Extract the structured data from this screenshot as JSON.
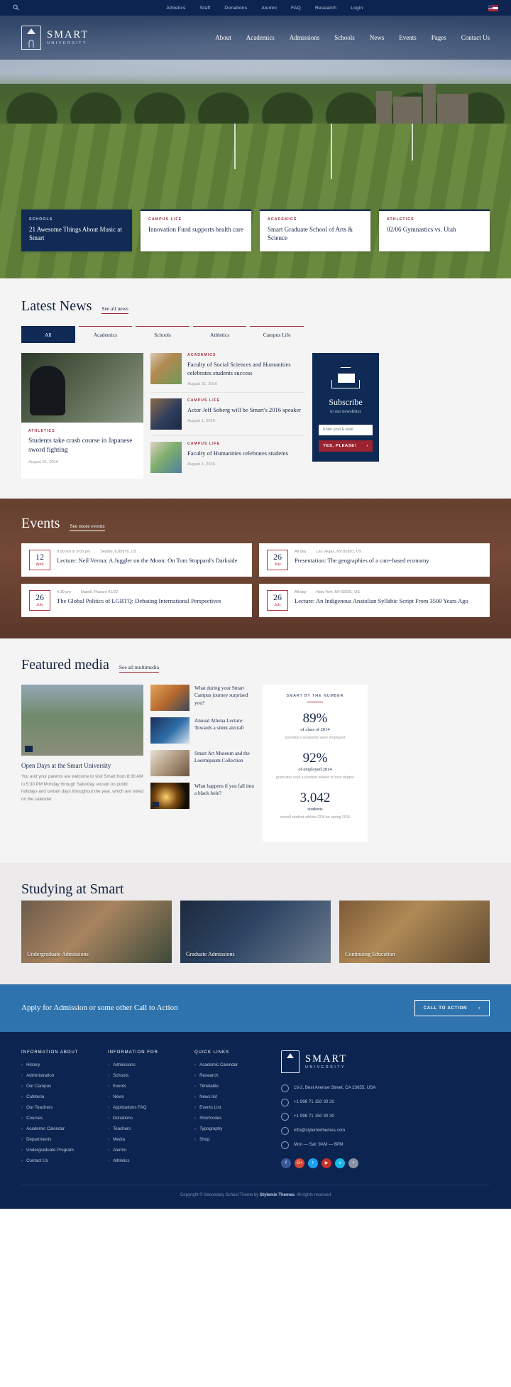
{
  "topbar": {
    "search_icon": "search-icon",
    "links": [
      "Athletics",
      "Staff",
      "Donations",
      "Alumni",
      "FAQ",
      "Research",
      "Login"
    ],
    "flag": "us-flag-icon"
  },
  "header": {
    "brand_main": "SMART",
    "brand_sub": "UNIVERSITY",
    "nav": [
      "About",
      "Academics",
      "Admissions",
      "Schools",
      "News",
      "Events",
      "Pages",
      "Contact Us"
    ]
  },
  "feature_cards": [
    {
      "category": "SCHOOLS",
      "title": "21 Awesome Things About Music at Smart",
      "dark": true
    },
    {
      "category": "CAMPUS LIFE",
      "title": "Innovation Fund supports health care",
      "dark": false
    },
    {
      "category": "ACADEMICS",
      "title": "Smart Graduate School of Arts & Science",
      "dark": false
    },
    {
      "category": "ATHLETICS",
      "title": "02/06 Gymnastics vs. Utah",
      "dark": false
    }
  ],
  "news": {
    "title": "Latest News",
    "see_all": "See all news",
    "tabs": [
      "All",
      "Academics",
      "Schools",
      "Athletics",
      "Campus Life"
    ],
    "active_tab": "All",
    "featured": {
      "category": "ATHLETICS",
      "title": "Students take crash course in Japanese sword fighting",
      "date": "August 31, 2016"
    },
    "items": [
      {
        "category": "ACADEMICS",
        "title": "Faculty of Social Sciences and Humanities celebrates students success",
        "date": "August 31, 2016"
      },
      {
        "category": "CAMPUS LIFE",
        "title": "Actor Jeff Soberg will be Smart's 2016 speaker",
        "date": "August 1, 2016"
      },
      {
        "category": "CAMPUS LIFE",
        "title": "Faculty of Humanities celebrates students",
        "date": "August 1, 2016"
      }
    ],
    "subscribe": {
      "icon": "envelope-icon",
      "title": "Subscribe",
      "subtitle": "to our newsletter",
      "placeholder": "Enter your E-mail",
      "button": "YES, PLEASE!",
      "button_arrow": "›"
    }
  },
  "events": {
    "title": "Events",
    "see_all": "See more events",
    "items": [
      {
        "day": "12",
        "month": "April",
        "time": "8:00 am to 9:00 pm",
        "location": "Seattle, IL85976, US",
        "title": "Lecture: Neil Verma: A Juggler on the Moon: On Tom Stoppard's Darkside"
      },
      {
        "day": "26",
        "month": "July",
        "time": "All day",
        "location": "Las Vegas, NV 82601, US",
        "title": "Presentation: The geographies of a care-based economy"
      },
      {
        "day": "26",
        "month": "July",
        "time": "4:30 pm",
        "location": "Napoli, Pizzaro 41/22",
        "title": "The Global Politics of LGBTQ: Debating International Perspectives"
      },
      {
        "day": "26",
        "month": "July",
        "time": "All day",
        "location": "New York, NY 82601, US",
        "title": "Lecture: An Indigenous Anatolian Syllabic Script From 3500 Years Ago"
      }
    ]
  },
  "media": {
    "title": "Featured media",
    "see_all": "See all multimedia",
    "main": {
      "title": "Open Days at the Smart University",
      "text": "You and your parents are welcome to visit Smart from 8:30 AM to 5:30 PM Monday through Saturday, except on public holidays and certain days throughout the year, which are noted on the calendar.",
      "play_icon": "play-icon"
    },
    "list": [
      {
        "title": "What during your Smart Campus journey surprised you?"
      },
      {
        "title": "Annual Athena Lecture: Towards a silent aircraft"
      },
      {
        "title": "Smart Art Museum and the Loermipsum Collection"
      },
      {
        "title": "What happens if you fall into a black hole?"
      }
    ],
    "stats": {
      "heading": "SMART BY THE NUMBER",
      "items": [
        {
          "number": "89%",
          "label": "of class of 2014",
          "detail": "bachelor's recipients were employed"
        },
        {
          "number": "92%",
          "label": "of employed 2014",
          "detail": "graduates hold a position related to their degree"
        },
        {
          "number": "3.042",
          "label": "students",
          "detail": "overall student-athlete GPA for spring 2016"
        }
      ]
    }
  },
  "study": {
    "title": "Studying at Smart",
    "cards": [
      "Undergraduate Admissions",
      "Graduate Admissions",
      "Continuing Education"
    ]
  },
  "cta": {
    "text": "Apply for Admission or some other Call to Action",
    "button": "CALL TO ACTION",
    "button_arrow": "›"
  },
  "footer": {
    "columns": [
      {
        "heading": "INFORMATION ABOUT",
        "links": [
          "History",
          "Administration",
          "Our Campus",
          "Cafeteria",
          "Our Teachers",
          "Courses",
          "Academic Calendar",
          "Departments",
          "Undergraduate Program",
          "Contact Us"
        ]
      },
      {
        "heading": "INFORMATION FOR",
        "links": [
          "Admissions",
          "Schools",
          "Events",
          "News",
          "Applications FAQ",
          "Donations",
          "Teachers",
          "Media",
          "Alumni",
          "Athletics"
        ]
      },
      {
        "heading": "QUICK LINKS",
        "links": [
          "Academic Calendar",
          "Research",
          "Timetable",
          "News list",
          "Events List",
          "Shortcodes",
          "Typography",
          "Shop"
        ]
      }
    ],
    "brand_main": "SMART",
    "brand_sub": "UNIVERSITY",
    "contacts": [
      {
        "icon": "location-icon",
        "text": "16-2, Best Avenue Street, CA 23655, USA"
      },
      {
        "icon": "phone-icon",
        "text": "+1 998 71 150 30 20"
      },
      {
        "icon": "fax-icon",
        "text": "+1 998 71 150 30 30"
      },
      {
        "icon": "mail-icon",
        "text": "info@stylemixthemes.com"
      },
      {
        "icon": "clock-icon",
        "text": "Mon — Sat: 9AM — 6PM"
      }
    ],
    "socials": [
      {
        "name": "facebook-icon",
        "glyph": "f",
        "color": "#3b5998"
      },
      {
        "name": "google-plus-icon",
        "glyph": "G+",
        "color": "#d34836"
      },
      {
        "name": "twitter-icon",
        "glyph": "t",
        "color": "#1da1f2"
      },
      {
        "name": "youtube-icon",
        "glyph": "▶",
        "color": "#c4302b"
      },
      {
        "name": "vimeo-icon",
        "glyph": "v",
        "color": "#1ab7ea"
      },
      {
        "name": "rss-icon",
        "glyph": "•",
        "color": "#8a93a5"
      }
    ],
    "copyright_pre": "Copyright © Secondary School Theme by ",
    "copyright_brand": "Stylemix Themes",
    "copyright_post": ". All rights reserved"
  }
}
